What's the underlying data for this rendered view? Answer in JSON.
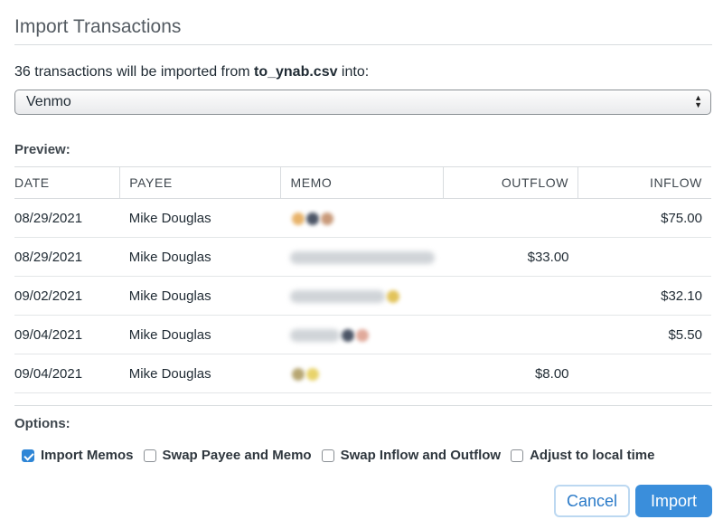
{
  "dialog": {
    "title": "Import Transactions"
  },
  "summary": {
    "prefix": "36 transactions will be imported from ",
    "filename": "to_ynab.csv",
    "suffix": " into:"
  },
  "account_select": {
    "value": "Venmo"
  },
  "preview": {
    "label": "Preview:",
    "columns": [
      "DATE",
      "PAYEE",
      "MEMO",
      "OUTFLOW",
      "INFLOW"
    ],
    "rows": [
      {
        "date": "08/29/2021",
        "payee": "Mike Douglas",
        "memo": "",
        "outflow": "",
        "inflow": "$75.00"
      },
      {
        "date": "08/29/2021",
        "payee": "Mike Douglas",
        "memo": "",
        "outflow": "$33.00",
        "inflow": ""
      },
      {
        "date": "09/02/2021",
        "payee": "Mike Douglas",
        "memo": "",
        "outflow": "",
        "inflow": "$32.10"
      },
      {
        "date": "09/04/2021",
        "payee": "Mike Douglas",
        "memo": "",
        "outflow": "",
        "inflow": "$5.50"
      },
      {
        "date": "09/04/2021",
        "payee": "Mike Douglas",
        "memo": "",
        "outflow": "$8.00",
        "inflow": ""
      }
    ]
  },
  "options": {
    "label": "Options:",
    "items": [
      {
        "label": "Import Memos",
        "checked": true
      },
      {
        "label": "Swap Payee and Memo",
        "checked": false
      },
      {
        "label": "Swap Inflow and Outflow",
        "checked": false
      },
      {
        "label": "Adjust to local time",
        "checked": false
      }
    ]
  },
  "buttons": {
    "cancel": "Cancel",
    "import": "Import"
  },
  "colors": {
    "accent": "#3a8edb",
    "cancel_text": "#2a7ac8"
  }
}
